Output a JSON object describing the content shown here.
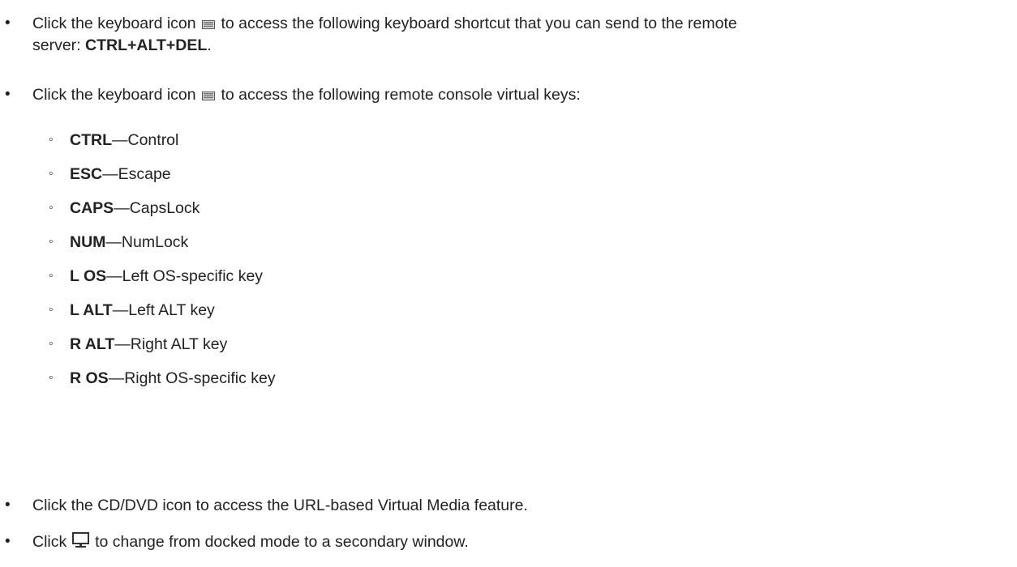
{
  "bullets": {
    "b1": {
      "pre": "Click the keyboard icon",
      "post": "to access the following keyboard shortcut that you can send to the remote",
      "line2_pre": "server: ",
      "line2_bold": "CTRL+ALT+DEL",
      "line2_post": "."
    },
    "b2": {
      "pre": "Click the keyboard icon",
      "post": "to access the following remote console virtual keys:"
    },
    "b3": {
      "text": "Click the CD/DVD icon to access the URL-based Virtual Media feature."
    },
    "b4": {
      "pre": "Click",
      "post": "to change from docked mode to a secondary window."
    }
  },
  "keys": [
    {
      "key": "CTRL",
      "desc": "—Control"
    },
    {
      "key": "ESC",
      "desc": "—Escape"
    },
    {
      "key": "CAPS",
      "desc": "—CapsLock"
    },
    {
      "key": "NUM",
      "desc": "—NumLock"
    },
    {
      "key": "L OS",
      "desc": "—Left OS-specific key"
    },
    {
      "key": "L ALT",
      "desc": "—Left ALT key"
    },
    {
      "key": "R ALT",
      "desc": "—Right ALT key"
    },
    {
      "key": "R OS",
      "desc": "—Right OS-specific key"
    }
  ],
  "icons": {
    "keyboard": "keyboard-icon",
    "monitor": "monitor-icon"
  }
}
